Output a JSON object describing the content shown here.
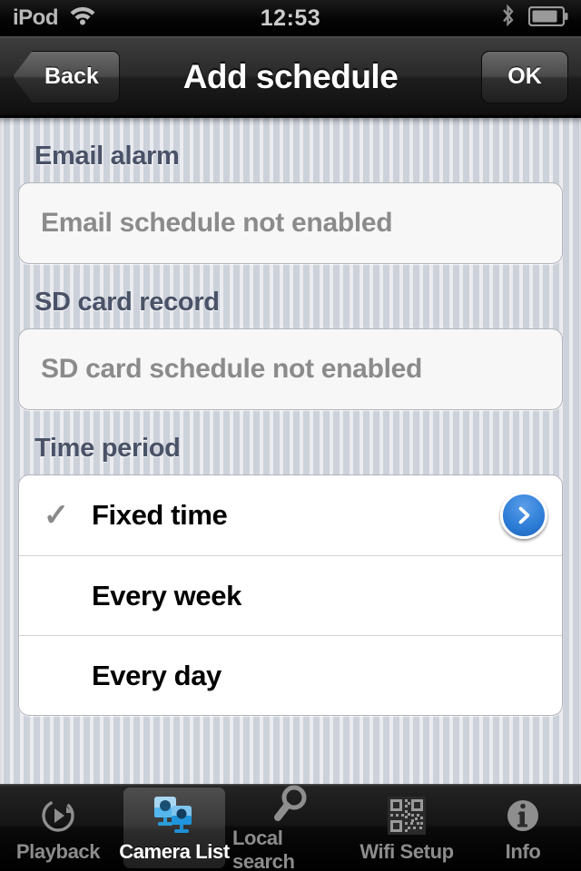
{
  "status_bar": {
    "carrier": "iPod",
    "wifi_icon": "wifi-icon",
    "time": "12:53",
    "bluetooth_icon": "bluetooth-icon",
    "battery_icon": "battery-icon",
    "battery_level_pct": 75
  },
  "nav_bar": {
    "back_label": "Back",
    "title": "Add schedule",
    "ok_label": "OK"
  },
  "sections": {
    "email_alarm": {
      "header": "Email alarm",
      "note": "Email schedule not enabled"
    },
    "sd_card_record": {
      "header": "SD card record",
      "note": "SD card schedule not enabled"
    },
    "time_period": {
      "header": "Time period",
      "rows": [
        {
          "label": "Fixed time",
          "checked": true,
          "checkmark": "✓",
          "disclosure": true
        },
        {
          "label": "Every week",
          "checked": false,
          "checkmark": "✓",
          "disclosure": false
        },
        {
          "label": "Every day",
          "checked": false,
          "checkmark": "✓",
          "disclosure": false
        }
      ]
    }
  },
  "tab_bar": {
    "items": [
      {
        "label": "Playback",
        "icon": "playback-icon",
        "selected": false
      },
      {
        "label": "Camera List",
        "icon": "camera-list-icon",
        "selected": true
      },
      {
        "label": "Local search",
        "icon": "search-icon",
        "selected": false
      },
      {
        "label": "Wifi Setup",
        "icon": "qr-code-icon",
        "selected": false
      },
      {
        "label": "Info",
        "icon": "info-icon",
        "selected": false
      }
    ]
  },
  "colors": {
    "accent_blue": "#2f7fd8",
    "background": "#ced3dd",
    "header_text": "#4a5267",
    "note_text": "#8b8b8b",
    "tab_selected_text": "#ffffff",
    "tab_text": "#8c8c8c"
  }
}
